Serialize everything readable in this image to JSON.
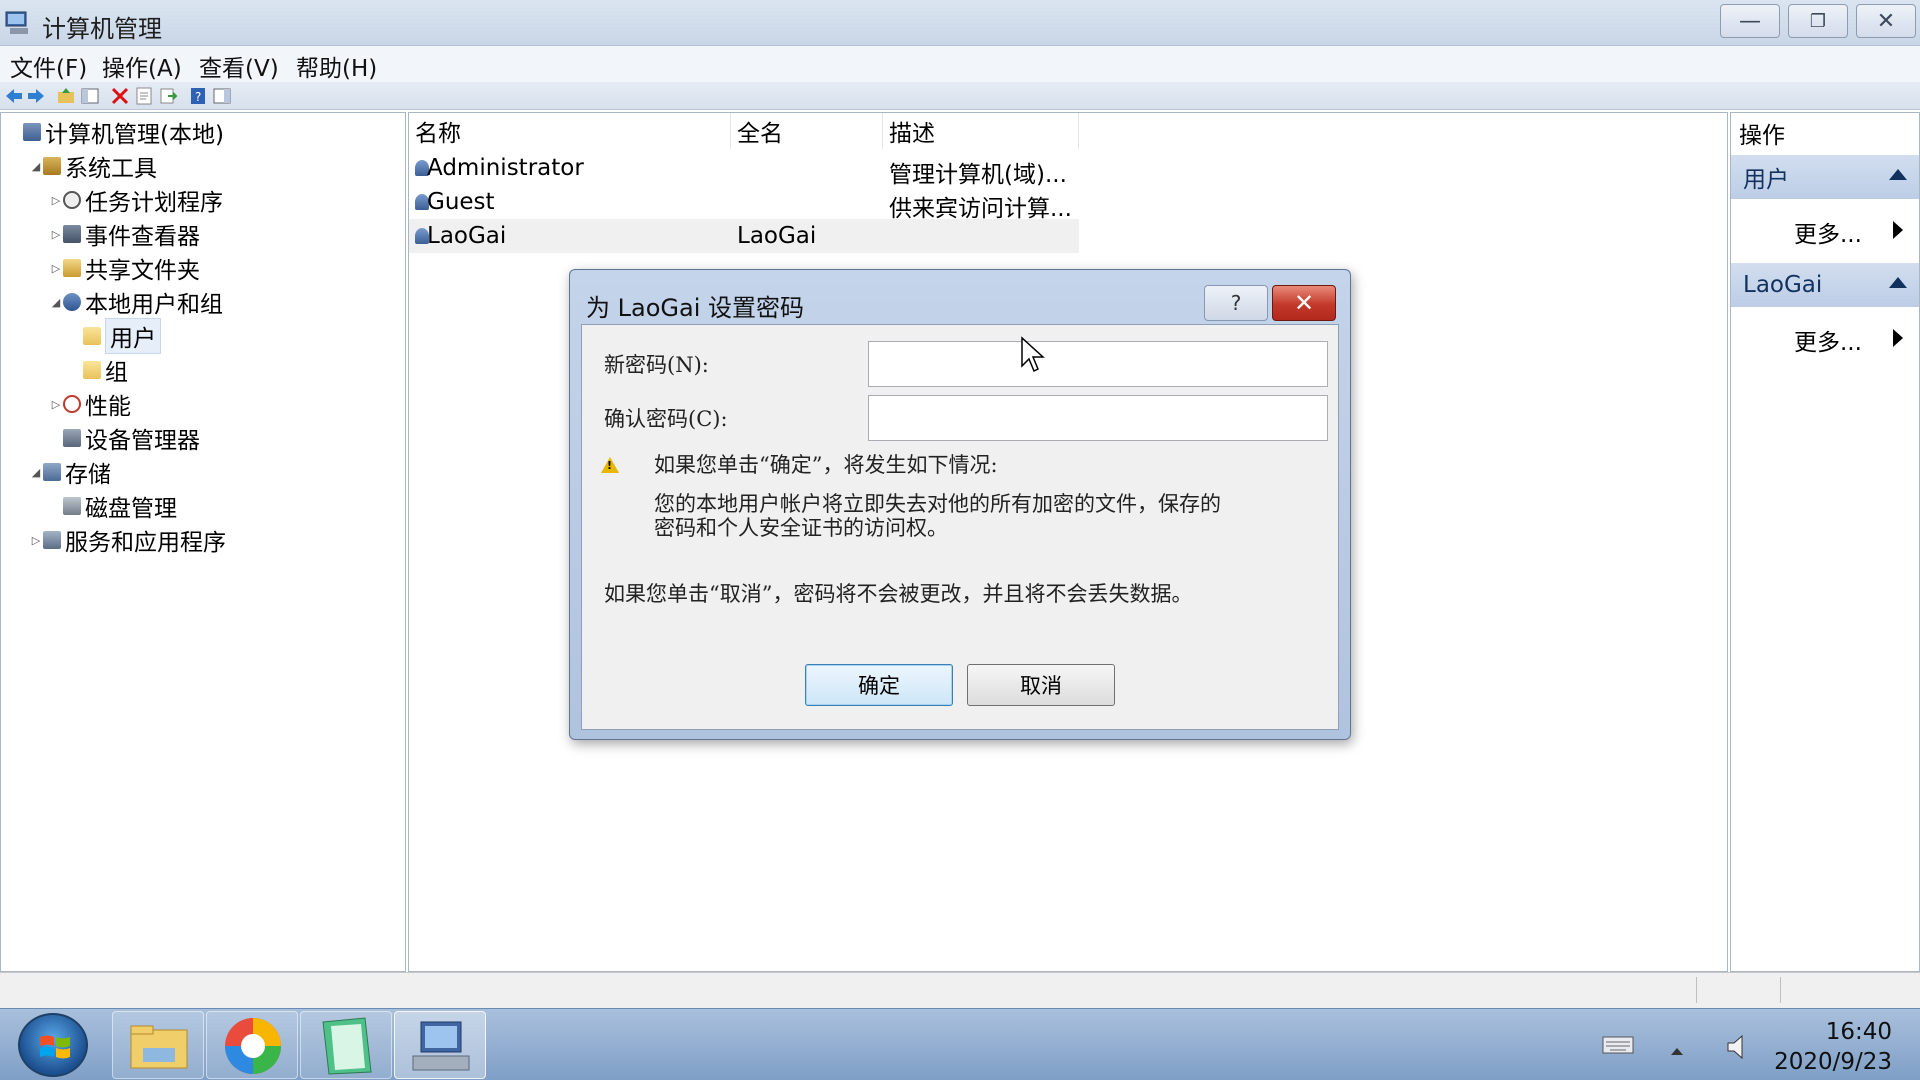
{
  "window": {
    "title": "计算机管理"
  },
  "menu": [
    "文件(F)",
    "操作(A)",
    "查看(V)",
    "帮助(H)"
  ],
  "tree": [
    {
      "label": "计算机管理(本地)",
      "icon": "computer-icon",
      "indent": 0,
      "expander": ""
    },
    {
      "label": "系统工具",
      "icon": "tools-icon",
      "indent": 1,
      "expander": "◢"
    },
    {
      "label": "任务计划程序",
      "icon": "clock-icon",
      "indent": 2,
      "expander": "▷"
    },
    {
      "label": "事件查看器",
      "icon": "event-viewer-icon",
      "indent": 2,
      "expander": "▷"
    },
    {
      "label": "共享文件夹",
      "icon": "shared-folder-icon",
      "indent": 2,
      "expander": "▷"
    },
    {
      "label": "本地用户和组",
      "icon": "users-icon",
      "indent": 2,
      "expander": "◢"
    },
    {
      "label": "用户",
      "icon": "folder-icon",
      "indent": 3,
      "expander": "",
      "selected": true
    },
    {
      "label": "组",
      "icon": "folder-icon",
      "indent": 3,
      "expander": ""
    },
    {
      "label": "性能",
      "icon": "performance-icon",
      "indent": 2,
      "expander": "▷"
    },
    {
      "label": "设备管理器",
      "icon": "device-manager-icon",
      "indent": 2,
      "expander": ""
    },
    {
      "label": "存储",
      "icon": "storage-icon",
      "indent": 1,
      "expander": "◢"
    },
    {
      "label": "磁盘管理",
      "icon": "disk-icon",
      "indent": 2,
      "expander": ""
    },
    {
      "label": "服务和应用程序",
      "icon": "services-icon",
      "indent": 1,
      "expander": "▷"
    }
  ],
  "list": {
    "columns": [
      "名称",
      "全名",
      "描述"
    ],
    "rows": [
      {
        "name": "Administrator",
        "fullname": "",
        "desc": "管理计算机(域)..."
      },
      {
        "name": "Guest",
        "fullname": "",
        "desc": "供来宾访问计算..."
      },
      {
        "name": "LaoGai",
        "fullname": "LaoGai",
        "desc": "",
        "selected": true
      }
    ]
  },
  "actions": {
    "header": "操作",
    "sections": [
      {
        "title": "用户",
        "more": "更多..."
      },
      {
        "title": "LaoGai",
        "more": "更多..."
      }
    ]
  },
  "dialog": {
    "title": "为 LaoGai 设置密码",
    "help": "?",
    "new_password_label": "新密码(N):",
    "confirm_password_label": "确认密码(C):",
    "new_password_value": "",
    "confirm_password_value": "",
    "warning_heading": "如果您单击“确定”，将发生如下情况:",
    "warning_line1": "您的本地用户帐户将立即失去对他的所有加密的文件，保存的",
    "warning_line2": "密码和个人安全证书的访问权。",
    "cancel_note": "如果您单击“取消”，密码将不会被更改，并且将不会丢失数据。",
    "ok_label": "确定",
    "cancel_label": "取消"
  },
  "taskbar": {
    "apps": [
      "file-explorer-icon",
      "browser-icon",
      "notepad-icon",
      "computer-management-icon"
    ],
    "time": "16:40",
    "date": "2020/9/23"
  },
  "colors": {
    "title_bar": "#c9d6e7",
    "taskbar": "#7f9fc6",
    "close_red": "#c2392a",
    "action_section": "#bccde6"
  }
}
